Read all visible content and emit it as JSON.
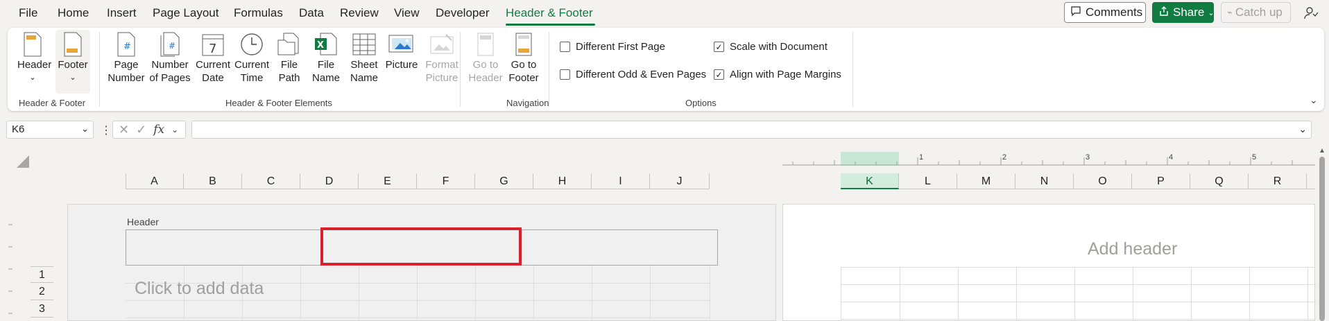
{
  "menu": {
    "tabs": [
      "File",
      "Home",
      "Insert",
      "Page Layout",
      "Formulas",
      "Data",
      "Review",
      "View",
      "Developer",
      "Header & Footer"
    ],
    "active_tab": "Header & Footer"
  },
  "topbar": {
    "comments": "Comments",
    "share": "Share",
    "catch_up": "Catch up"
  },
  "ribbon": {
    "header_footer_group": {
      "header": "Header",
      "footer": "Footer",
      "label": "Header & Footer"
    },
    "elements_group": {
      "page_number_1": "Page",
      "page_number_2": "Number",
      "num_pages_1": "Number",
      "num_pages_2": "of Pages",
      "current_date_1": "Current",
      "current_date_2": "Date",
      "current_time_1": "Current",
      "current_time_2": "Time",
      "file_path_1": "File",
      "file_path_2": "Path",
      "file_name_1": "File",
      "file_name_2": "Name",
      "sheet_name_1": "Sheet",
      "sheet_name_2": "Name",
      "picture": "Picture",
      "format_picture_1": "Format",
      "format_picture_2": "Picture",
      "label": "Header & Footer Elements"
    },
    "navigation_group": {
      "go_header_1": "Go to",
      "go_header_2": "Header",
      "go_footer_1": "Go to",
      "go_footer_2": "Footer",
      "label": "Navigation"
    },
    "options_group": {
      "different_first_page": "Different First Page",
      "different_odd_even": "Different Odd & Even Pages",
      "scale_with_document": "Scale with Document",
      "align_with_margins": "Align with Page Margins",
      "label": "Options",
      "different_first_page_checked": false,
      "different_odd_even_checked": false,
      "scale_with_document_checked": true,
      "align_with_margins_checked": true
    }
  },
  "formula_bar": {
    "name_box": "K6",
    "fx": "fx",
    "value": ""
  },
  "sheet": {
    "columns_left": [
      "A",
      "B",
      "C",
      "D",
      "E",
      "F",
      "G",
      "H",
      "I",
      "J"
    ],
    "columns_right": [
      "K",
      "L",
      "M",
      "N",
      "O",
      "P",
      "Q",
      "R"
    ],
    "rows": [
      "1",
      "2",
      "3"
    ],
    "ruler_numbers": [
      "1",
      "2",
      "3",
      "4",
      "5"
    ],
    "header_label": "Header",
    "click_to_add": "Click to add data",
    "add_header": "Add header",
    "selected_column": "K"
  },
  "colors": {
    "accent": "#107c41",
    "highlight": "#d9212b"
  }
}
